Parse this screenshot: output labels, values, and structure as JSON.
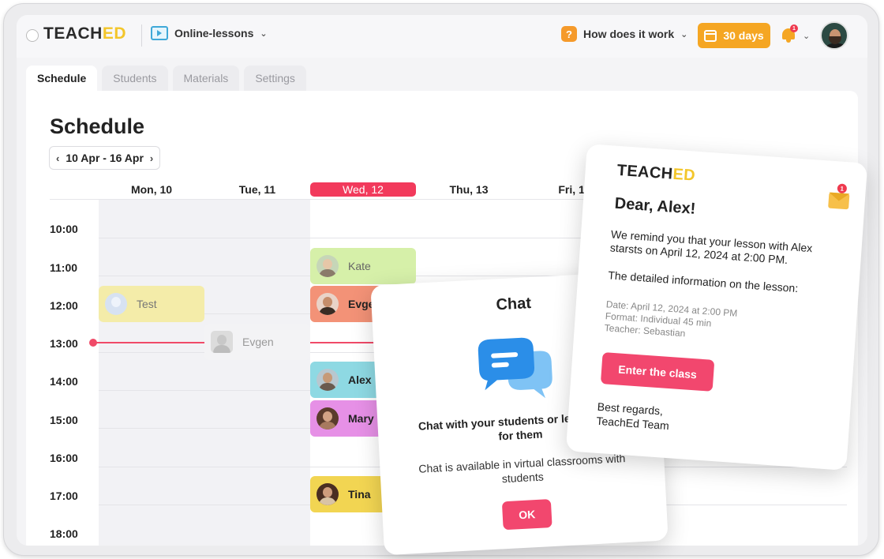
{
  "header": {
    "logo_main": "TEACH",
    "logo_accent": "ED",
    "course": "Online-lessons",
    "how_it_works": "How does it work",
    "trial_days": "30 days",
    "notification_count": "1"
  },
  "tabs": [
    {
      "label": "Schedule",
      "active": true
    },
    {
      "label": "Students",
      "active": false
    },
    {
      "label": "Materials",
      "active": false
    },
    {
      "label": "Settings",
      "active": false
    }
  ],
  "schedule": {
    "title": "Schedule",
    "week_range": "10 Apr - 16 Apr",
    "days": [
      "Mon, 10",
      "Tue, 11",
      "Wed, 12",
      "Thu, 13",
      "Fri, 14"
    ],
    "today_index": 2,
    "times": [
      "10:00",
      "11:00",
      "12:00",
      "13:00",
      "14:00",
      "15:00",
      "16:00",
      "17:00",
      "18:00"
    ],
    "events": [
      {
        "name": "Test",
        "day": 0,
        "time": "12:00",
        "color": "#f4eca9",
        "style": "light"
      },
      {
        "name": "Evgen",
        "day": 1,
        "time": "13:00",
        "color": "#f0f0f2",
        "style": "faded"
      },
      {
        "name": "Kate",
        "day": 2,
        "time": "11:00",
        "color": "#d6f0a9",
        "style": "light"
      },
      {
        "name": "Evgen",
        "day": 2,
        "time": "12:00",
        "color": "#f39277",
        "style": "bold"
      },
      {
        "name": "Alex",
        "day": 2,
        "time": "14:00",
        "color": "#8ed9e3",
        "style": "bold"
      },
      {
        "name": "Mary",
        "day": 2,
        "time": "15:00",
        "color": "#e690e6",
        "style": "bold"
      },
      {
        "name": "Tina",
        "day": 2,
        "time": "17:00",
        "color": "#f2d552",
        "style": "bold"
      }
    ]
  },
  "chat_card": {
    "title": "Chat",
    "subtitle": "Chat with your students or leave notes for them",
    "description": "Chat is available in virtual classrooms with students",
    "ok_label": "OK"
  },
  "email_card": {
    "logo_main": "TEACH",
    "logo_accent": "ED",
    "notification_count": "1",
    "greeting": "Dear, Alex!",
    "reminder": "We remind you that your lesson with Alex starsts on April 12, 2024 at 2:00 PM.",
    "details_heading": "The detailed information on the lesson:",
    "date_line": "Date: April 12, 2024 at 2:00 PM",
    "format_line": "Format: Individual 45 min",
    "teacher_line": "Teacher: Sebastian",
    "enter_label": "Enter the class",
    "regards_line1": "Best regards,",
    "regards_line2": "TeachEd Team"
  },
  "colors": {
    "accent": "#f2476e",
    "today": "#f23a5c",
    "trial": "#f5a623",
    "brand_yellow": "#f3c62b"
  }
}
